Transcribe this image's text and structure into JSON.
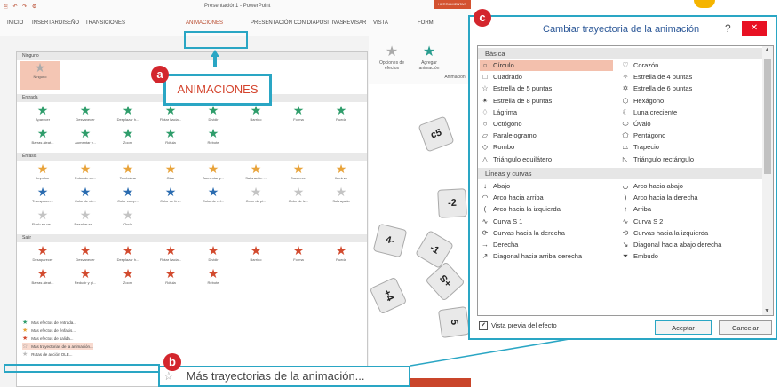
{
  "window": {
    "title": "Presentación1 - PowerPoint",
    "tools_label": "HERRAMIENTAS"
  },
  "tabs": [
    "INICIO",
    "INSERTAR",
    "DISEÑO",
    "TRANSICIONES",
    "ANIMACIONES",
    "PRESENTACIÓN CON DIAPOSITIVAS",
    "REVISAR",
    "VISTA",
    "FORM"
  ],
  "ribbon": {
    "effect_options": "Opciones de efectos",
    "add_animation": "Agregar animación",
    "group_label": "Animación"
  },
  "gallery": {
    "none_header": "Ninguno",
    "none_item": "Ninguno",
    "entrada_header": "Entrada",
    "entrada": [
      "Aparecer",
      "Desvanecer",
      "Desplazar h...",
      "Flotar hacia...",
      "Dividir",
      "Barrido",
      "Forma",
      "Rueda",
      "Barras aleat...",
      "Aumentar y...",
      "Zoom",
      "Rótula",
      "Rebote"
    ],
    "enfasis_header": "Énfasis",
    "enfasis": [
      "Impulso",
      "Pulso de co...",
      "Tambalear",
      "Girar",
      "Aumentar y...",
      "Saturación ...",
      "Oscurecer",
      "Iluminar",
      "Transparen...",
      "Color de ob...",
      "Color comp...",
      "Color de lín...",
      "Color de rel...",
      "Color de pi...",
      "Color de le...",
      "Subrayado",
      "Flash en ne...",
      "Resaltar en ...",
      "Onda"
    ],
    "salir_header": "Salir",
    "salir": [
      "Desaparecer",
      "Desvanecer",
      "Desplazar h...",
      "Flotar hacia...",
      "Dividir",
      "Barrido",
      "Forma",
      "Rueda",
      "Barras aleat...",
      "Reducir y gi...",
      "Zoom",
      "Rótula",
      "Rebote"
    ],
    "more": [
      "Más efectos de entrada...",
      "Más efectos de énfasis...",
      "Más efectos de salida...",
      "Más trayectorias de la animación...",
      "Rutas de acción OLE..."
    ]
  },
  "callouts": {
    "a_badge": "a",
    "a_text": "ANIMACIONES",
    "b_badge": "b",
    "b_text": "Más trayectorias de la animación...",
    "c_badge": "c"
  },
  "dialog": {
    "title": "Cambiar trayectoria de la animación",
    "help": "?",
    "close": "✕",
    "basic_header": "Básica",
    "basic": [
      {
        "icon": "circle-icon",
        "glyph": "○",
        "label": "Círculo",
        "selected": true
      },
      {
        "icon": "heart-icon",
        "glyph": "♡",
        "label": "Corazón"
      },
      {
        "icon": "square-icon",
        "glyph": "□",
        "label": "Cuadrado"
      },
      {
        "icon": "star4-icon",
        "glyph": "✧",
        "label": "Estrella de 4 puntas"
      },
      {
        "icon": "star5-icon",
        "glyph": "☆",
        "label": "Estrella de 5 puntas"
      },
      {
        "icon": "star6-icon",
        "glyph": "✡",
        "label": "Estrella de 6 puntas"
      },
      {
        "icon": "star8-icon",
        "glyph": "✴",
        "label": "Estrella de 8 puntas"
      },
      {
        "icon": "hexagon-icon",
        "glyph": "⬡",
        "label": "Hexágono"
      },
      {
        "icon": "teardrop-icon",
        "glyph": "♢",
        "label": "Lágrima"
      },
      {
        "icon": "moon-icon",
        "glyph": "☾",
        "label": "Luna creciente"
      },
      {
        "icon": "octagon-icon",
        "glyph": "○",
        "label": "Octógono"
      },
      {
        "icon": "oval-icon",
        "glyph": "⬭",
        "label": "Óvalo"
      },
      {
        "icon": "parallelogram-icon",
        "glyph": "▱",
        "label": "Paralelogramo"
      },
      {
        "icon": "pentagon-icon",
        "glyph": "⬠",
        "label": "Pentágono"
      },
      {
        "icon": "diamond-icon",
        "glyph": "◇",
        "label": "Rombo"
      },
      {
        "icon": "trapezoid-icon",
        "glyph": "⏢",
        "label": "Trapecio"
      },
      {
        "icon": "triangle-icon",
        "glyph": "△",
        "label": "Triángulo equilátero"
      },
      {
        "icon": "right-triangle-icon",
        "glyph": "◺",
        "label": "Triángulo rectángulo"
      }
    ],
    "lines_header": "Líneas y curvas",
    "lines": [
      {
        "icon": "down-line-icon",
        "glyph": "↓",
        "label": "Abajo"
      },
      {
        "icon": "arc-down-icon",
        "glyph": "◡",
        "label": "Arco hacia abajo"
      },
      {
        "icon": "arc-up-icon",
        "glyph": "◠",
        "label": "Arco hacia arriba"
      },
      {
        "icon": "arc-right-icon",
        "glyph": ")",
        "label": "Arco hacia la derecha"
      },
      {
        "icon": "arc-left-icon",
        "glyph": "(",
        "label": "Arco hacia la izquierda"
      },
      {
        "icon": "up-line-icon",
        "glyph": "↑",
        "label": "Arriba"
      },
      {
        "icon": "s-curve1-icon",
        "glyph": "∿",
        "label": "Curva S 1"
      },
      {
        "icon": "s-curve2-icon",
        "glyph": "∿",
        "label": "Curva S 2"
      },
      {
        "icon": "curves-right-icon",
        "glyph": "⟳",
        "label": "Curvas hacia la derecha"
      },
      {
        "icon": "curves-left-icon",
        "glyph": "⟲",
        "label": "Curvas hacia la izquierda"
      },
      {
        "icon": "right-line-icon",
        "glyph": "→",
        "label": "Derecha"
      },
      {
        "icon": "diag-down-right-icon",
        "glyph": "↘",
        "label": "Diagonal hacia abajo derecha"
      },
      {
        "icon": "diag-up-right-icon",
        "glyph": "↗",
        "label": "Diagonal hacia arriba derecha"
      },
      {
        "icon": "funnel-icon",
        "glyph": "⏷",
        "label": "Embudo"
      }
    ],
    "preview_label": "Vista previa del efecto",
    "preview_checked": true,
    "ok": "Aceptar",
    "cancel": "Cancelar"
  },
  "slide": {
    "dice": [
      "c5",
      "-2",
      "4-",
      "-1",
      "S+",
      "+4",
      "5"
    ]
  },
  "colors": {
    "accent": "#2aa6c4",
    "brand": "#b7472a",
    "badge": "#d3262d",
    "selected": "#f3c0ad"
  }
}
